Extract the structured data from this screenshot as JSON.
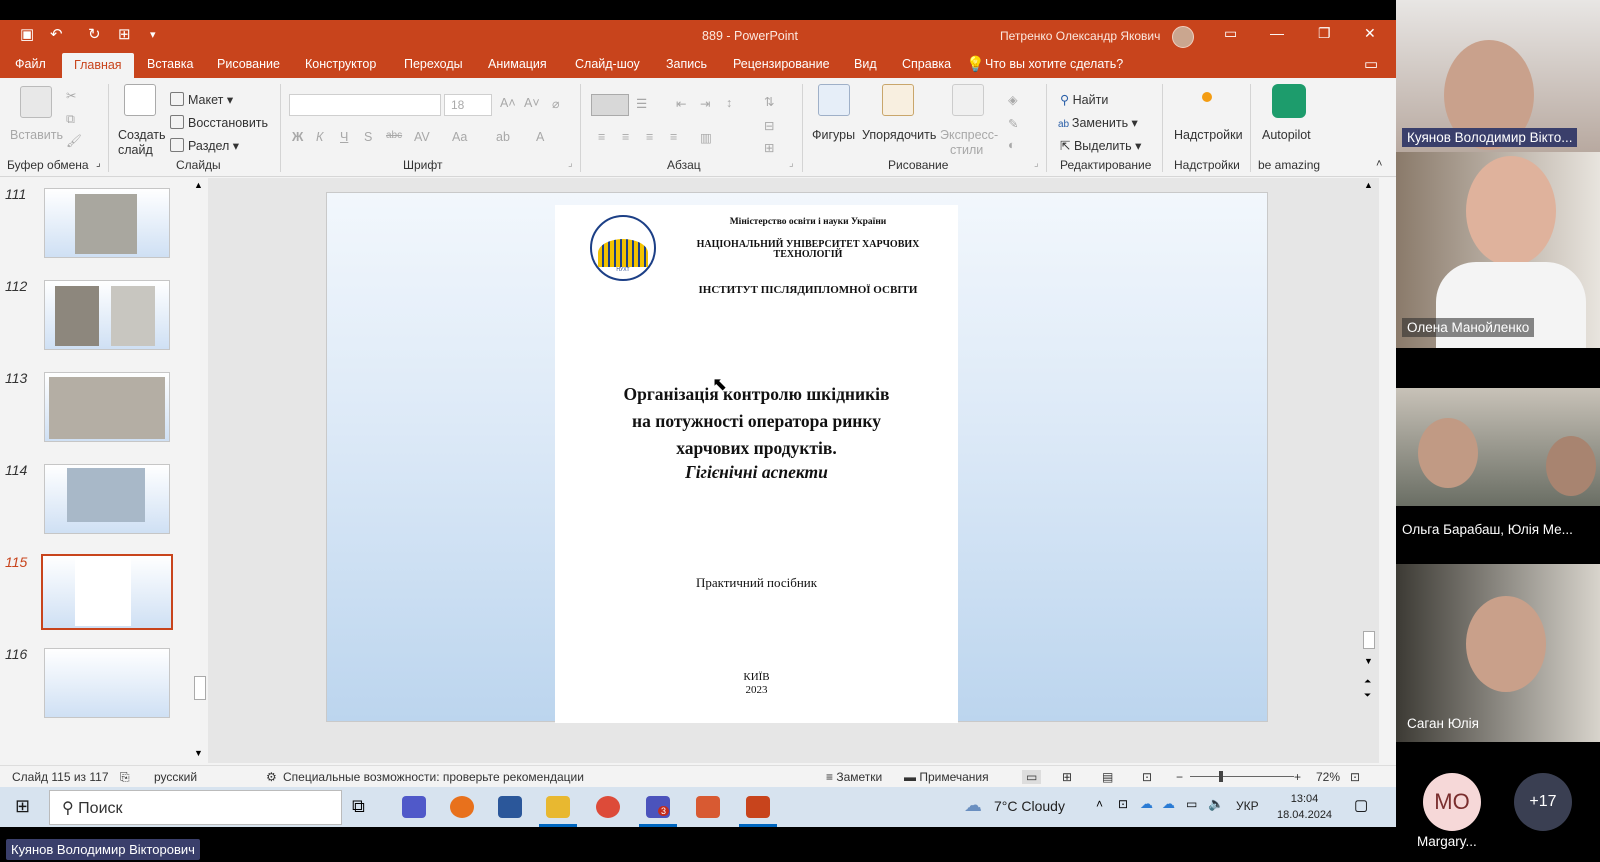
{
  "titlebar": {
    "doc_title": "889  -  PowerPoint",
    "user": "Петренко Олександр Якович"
  },
  "menu": {
    "items": [
      "Файл",
      "Главная",
      "Вставка",
      "Рисование",
      "Конструктор",
      "Переходы",
      "Анимация",
      "Слайд-шоу",
      "Запись",
      "Рецензирование",
      "Вид",
      "Справка"
    ],
    "active": "Главная",
    "tell_me": "Что вы хотите сделать?"
  },
  "ribbon": {
    "paste": "Вставить",
    "new_slide_1": "Создать",
    "new_slide_2": "слайд",
    "layout": "Макет",
    "reset": "Восстановить",
    "section": "Раздел",
    "font_size": "18",
    "shapes": "Фигуры",
    "arrange": "Упорядочить",
    "quick_styles_1": "Экспресс-",
    "quick_styles_2": "стили",
    "find": "Найти",
    "replace": "Заменить",
    "select": "Выделить",
    "addins": "Надстройки",
    "autopilot": "Autopilot",
    "groups": {
      "clipboard": "Буфер обмена",
      "slides": "Слайды",
      "font": "Шрифт",
      "paragraph": "Абзац",
      "drawing": "Рисование",
      "editing": "Редактирование",
      "addins": "Надстройки",
      "amazing": "be amazing"
    }
  },
  "thumbnails": {
    "numbers": [
      "111",
      "112",
      "113",
      "114",
      "115",
      "116"
    ],
    "selected": "115"
  },
  "slide_page": {
    "ministry": "Міністерство освіти і науки України",
    "university_1": "НАЦІОНАЛЬНИЙ УНІВЕРСИТЕТ ХАРЧОВИХ",
    "university_2": "ТЕХНОЛОГІЙ",
    "institute": "ІНСТИТУТ ПІСЛЯДИПЛОМНОЇ ОСВІТИ",
    "logo_text": "НУХТ",
    "title_1": "Організація контролю шкідників",
    "title_2": "на потужності оператора ринку",
    "title_3": "харчових продуктів.",
    "subtitle": "Гігієнічні аспекти",
    "guide": "Практичний посібник",
    "city": "КИЇВ",
    "year": "2023"
  },
  "status": {
    "slide_count": "Слайд 115 из 117",
    "language": "русский",
    "accessibility": "Специальные возможности: проверьте рекомендации",
    "notes": "Заметки",
    "comments": "Примечания",
    "zoom": "72%"
  },
  "taskbar": {
    "search": "Поиск",
    "weather": "7°C  Cloudy",
    "lang": "УКР",
    "time": "13:04",
    "date": "18.04.2024",
    "teams_badge": "3"
  },
  "participants": {
    "tile1": "Куянов Володимир Вікто...",
    "tile2": "Олена Манойленко",
    "tile3": "Ольга Барабаш, Юлія Ме...",
    "tile4": "Саган Юлія",
    "avatar_initials": "МО",
    "avatar_name": "Margary...",
    "more_count": "+17",
    "active_speaker": "Куянов Володимир Вікторович"
  },
  "colors": {
    "accent": "#c8441c",
    "selected_thumb": "#c8441c"
  }
}
